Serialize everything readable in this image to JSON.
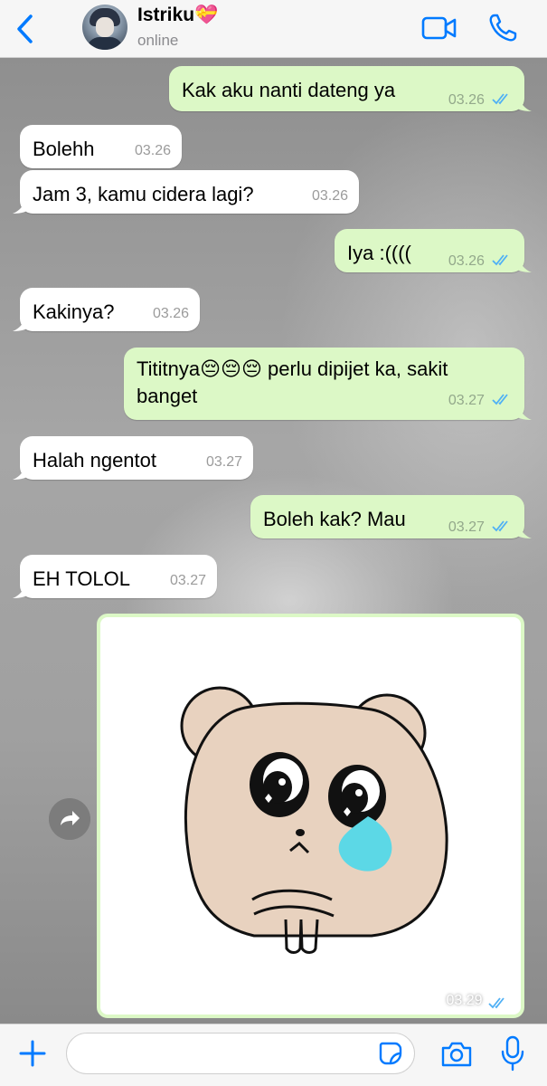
{
  "header": {
    "contact_name": "Istriku💝",
    "status": "online"
  },
  "messages": [
    {
      "dir": "out",
      "text": "Kak aku nanti dateng ya",
      "time": "03.26"
    },
    {
      "dir": "in",
      "text": "Bolehh",
      "time": "03.26"
    },
    {
      "dir": "in",
      "text": "Jam 3, kamu cidera lagi?",
      "time": "03.26"
    },
    {
      "dir": "out",
      "text": "Iya :((((",
      "time": "03.26"
    },
    {
      "dir": "in",
      "text": "Kakinya?",
      "time": "03.26"
    },
    {
      "dir": "out",
      "text_line1": "Tititnya😔😔😔 perlu dipijet ka, sakit",
      "text_line2": "banget",
      "time": "03.27"
    },
    {
      "dir": "in",
      "text": "Halah ngentot",
      "time": "03.27"
    },
    {
      "dir": "out",
      "text": "Boleh kak? Mau",
      "time": "03.27"
    },
    {
      "dir": "in",
      "text": "EH TOLOL",
      "time": "03.27"
    },
    {
      "dir": "out",
      "type": "sticker",
      "sticker": "crying-bear-sticker",
      "time": "03.29"
    }
  ],
  "composer": {
    "placeholder": ""
  },
  "icons": {
    "back": "chevron-left-icon",
    "video": "video-camera-icon",
    "phone": "phone-icon",
    "plus": "plus-icon",
    "sticker": "sticker-icon",
    "camera": "camera-icon",
    "mic": "microphone-icon",
    "forward": "forward-icon",
    "read": "double-check-icon"
  },
  "colors": {
    "accent": "#007aff",
    "outgoing_bubble": "#dcf8c6",
    "incoming_bubble": "#ffffff",
    "read_ticks": "#4fb0f5"
  }
}
